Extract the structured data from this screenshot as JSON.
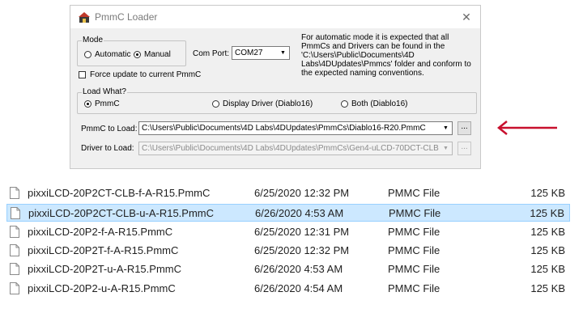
{
  "dialog": {
    "title": "PmmC Loader",
    "mode": {
      "legend": "Mode",
      "automatic_label": "Automatic",
      "manual_label": "Manual",
      "selected": "Manual"
    },
    "com_port": {
      "label": "Com Port:",
      "value": "COM27"
    },
    "info_text": "For automatic mode it is expected that all PmmCs and Drivers can be found in the 'C:\\Users\\Public\\Documents\\4D Labs\\4DUpdates\\Pmmcs' folder and conform to the expected naming conventions.",
    "force_update_label": "Force update to current PmmC",
    "load_what": {
      "legend": "Load What?",
      "options": [
        "PmmC",
        "Display Driver (Diablo16)",
        "Both (Diablo16)"
      ],
      "selected": "PmmC"
    },
    "pmmc_to_load": {
      "label": "PmmC to Load:",
      "value": "C:\\Users\\Public\\Documents\\4D Labs\\4DUpdates\\PmmCs\\Diablo16-R20.PmmC",
      "browse_label": "..."
    },
    "driver_to_load": {
      "label": "Driver to Load:",
      "value": "C:\\Users\\Public\\Documents\\4D Labs\\4DUpdates\\PmmCs\\Gen4-uLCD-70DCT-CLB",
      "browse_label": "..."
    }
  },
  "annotation": {
    "arrow_color": "#c8102e"
  },
  "files": [
    {
      "name": "pixxiLCD-20P2CT-CLB-f-A-R15.PmmC",
      "date": "6/25/2020 12:32 PM",
      "type": "PMMC File",
      "size": "125 KB",
      "selected": false
    },
    {
      "name": "pixxiLCD-20P2CT-CLB-u-A-R15.PmmC",
      "date": "6/26/2020 4:53 AM",
      "type": "PMMC File",
      "size": "125 KB",
      "selected": true
    },
    {
      "name": "pixxiLCD-20P2-f-A-R15.PmmC",
      "date": "6/25/2020 12:31 PM",
      "type": "PMMC File",
      "size": "125 KB",
      "selected": false
    },
    {
      "name": "pixxiLCD-20P2T-f-A-R15.PmmC",
      "date": "6/25/2020 12:32 PM",
      "type": "PMMC File",
      "size": "125 KB",
      "selected": false
    },
    {
      "name": "pixxiLCD-20P2T-u-A-R15.PmmC",
      "date": "6/26/2020 4:53 AM",
      "type": "PMMC File",
      "size": "125 KB",
      "selected": false
    },
    {
      "name": "pixxiLCD-20P2-u-A-R15.PmmC",
      "date": "6/26/2020 4:54 AM",
      "type": "PMMC File",
      "size": "125 KB",
      "selected": false
    }
  ]
}
